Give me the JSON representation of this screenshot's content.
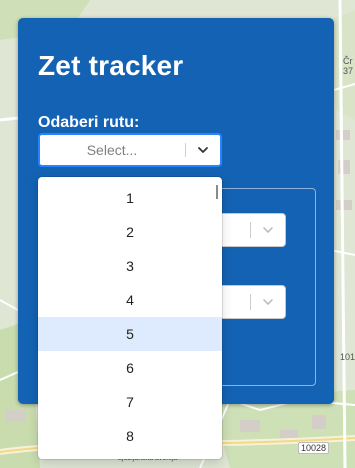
{
  "app": {
    "title": "Zet tracker"
  },
  "route": {
    "label": "Odaberi rutu:",
    "placeholder": "Select...",
    "options": [
      "1",
      "2",
      "3",
      "4",
      "5",
      "6",
      "7",
      "8"
    ],
    "focused_option": "5"
  },
  "map": {
    "labels": {
      "postcode": "10028",
      "street": "Ljubljanska avenija",
      "edge_top": "Čr",
      "edge_top2": "37",
      "edge_right": "101"
    }
  },
  "colors": {
    "panel": "#1462b3",
    "focus_border": "#2684ff",
    "option_highlight": "#deebff"
  },
  "icons": {
    "dropdown": "chevron-down-icon"
  }
}
